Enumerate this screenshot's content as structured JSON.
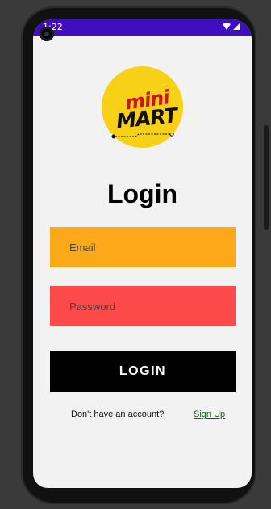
{
  "status_bar": {
    "time": "1:22",
    "background": "#3f0fbf"
  },
  "logo": {
    "word_top": "mini",
    "word_bottom": "MART",
    "circle_color": "#f7d117",
    "mini_color": "#d0132a"
  },
  "login": {
    "title": "Login",
    "email_placeholder": "Email",
    "password_placeholder": "Password",
    "submit_label": "LOGIN",
    "signup_prompt": "Don't have an account?",
    "signup_link": "Sign Up"
  },
  "colors": {
    "email_field": "#fba918",
    "password_field": "#fc4a4a",
    "button": "#000000",
    "screen_bg": "#f2f2f2"
  },
  "icons": [
    "camera-icon",
    "mic-icon",
    "wifi-icon",
    "signal-icon"
  ]
}
